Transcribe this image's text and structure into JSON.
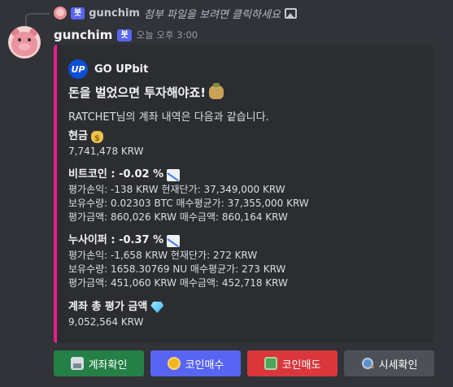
{
  "reply": {
    "bot_tag": "봇",
    "username": "gunchim",
    "text": "첨부 파일을 보려면 클릭하세요"
  },
  "message": {
    "username": "gunchim",
    "bot_tag": "봇",
    "timestamp": "오늘 오후 3:00"
  },
  "embed": {
    "accent_color": "#e91e8c",
    "author_logo": "UP",
    "author_name": "GO UPbit",
    "title": "돈을 벌었으면 투자해야죠!",
    "description": "RATCHET님의 계좌 내역은 다음과 같습니다.",
    "cash": {
      "name": "현금",
      "value": "7,741,478 KRW"
    },
    "bitcoin": {
      "name": "비트코인 : -0.02 %",
      "line1": "평가손익: -138 KRW 현재단가: 37,349,000 KRW",
      "line2": "보유수량: 0.02303 BTC 매수평균가: 37,355,000 KRW",
      "line3": "평가금액: 860,026 KRW 매수금액: 860,164 KRW"
    },
    "nucypher": {
      "name": "누사이퍼 : -0.37 %",
      "line1": "평가손익: -1,658 KRW 현재단가: 272 KRW",
      "line2": "보유수량: 1658.30769 NU 매수평균가: 273 KRW",
      "line3": "평가금액: 451,060 KRW 매수금액: 452,718 KRW"
    },
    "total": {
      "name": "계좌 총 평가 금액",
      "value": "9,052,564 KRW"
    }
  },
  "buttons": {
    "account": "계좌확인",
    "buy": "코인매수",
    "sell": "코인매도",
    "price": "시세확인"
  }
}
